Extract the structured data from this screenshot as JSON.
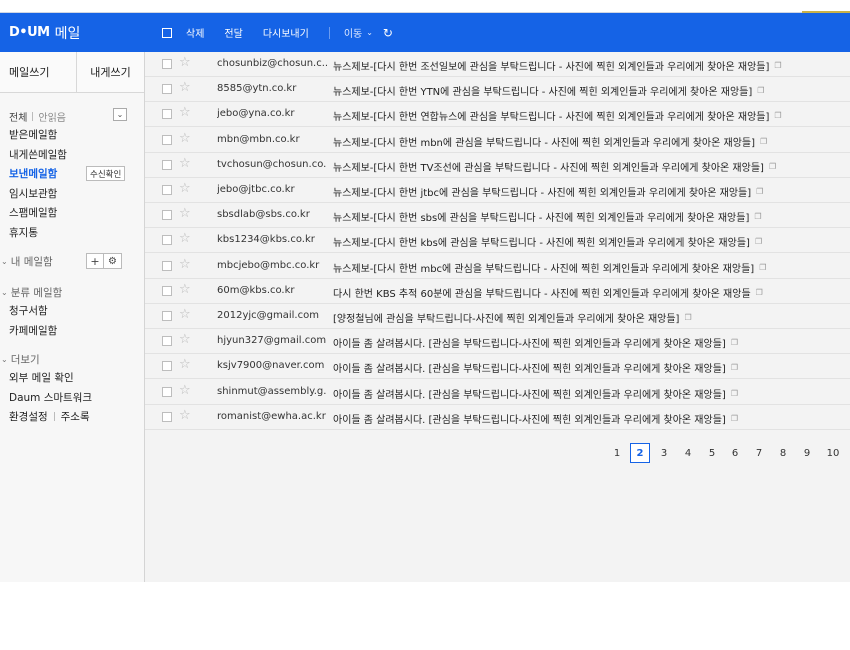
{
  "header": {
    "logo": "D•UM",
    "service": "메일",
    "toolbar": {
      "delete": "삭제",
      "forward": "전달",
      "resend": "다시보내기",
      "move": "이동"
    }
  },
  "sidebar": {
    "compose": "메일쓰기",
    "to_me": "내게쓰기",
    "filter_all": "전체",
    "filter_unread": "안읽음",
    "folders": [
      {
        "label": "받은메일함"
      },
      {
        "label": "내게쓴메일함"
      },
      {
        "label": "보낸메일함",
        "badge": "수신확인"
      },
      {
        "label": "임시보관함"
      },
      {
        "label": "스팸메일함"
      },
      {
        "label": "휴지통"
      }
    ],
    "my_mailbox": "내 메일함",
    "category_head": "분류 메일함",
    "categories": [
      {
        "label": "청구서함"
      },
      {
        "label": "카페메일함"
      }
    ],
    "more_head": "더보기",
    "more": {
      "external": "외부 메일 확인",
      "smartwork": "Daum 스마트워크",
      "settings": "환경설정",
      "contacts": "주소록"
    }
  },
  "mails": [
    {
      "from": "chosunbiz@chosun.c...",
      "subject": "뉴스제보-[다시 한번 조선일보에 관심을 부탁드립니다 - 사진에 찍힌 외계인들과 우리에게 찾아온 재앙들]"
    },
    {
      "from": "8585@ytn.co.kr",
      "subject": "뉴스제보-[다시 한번 YTN에 관심을 부탁드립니다 - 사진에 찍힌 외계인들과 우리에게 찾아온 재앙들]"
    },
    {
      "from": "jebo@yna.co.kr",
      "subject": "뉴스제보-[다시 한번 연합뉴스에 관심을 부탁드립니다 - 사진에 찍힌 외계인들과 우리에게 찾아온 재앙들]"
    },
    {
      "from": "mbn@mbn.co.kr",
      "subject": "뉴스제보-[다시 한번 mbn에 관심을 부탁드립니다 - 사진에 찍힌 외계인들과 우리에게 찾아온 재앙들]"
    },
    {
      "from": "tvchosun@chosun.co...",
      "subject": "뉴스제보-[다시 한번 TV조선에 관심을 부탁드립니다 - 사진에 찍힌 외계인들과 우리에게 찾아온 재앙들]"
    },
    {
      "from": "jebo@jtbc.co.kr",
      "subject": "뉴스제보-[다시 한번 jtbc에 관심을 부탁드립니다 - 사진에 찍힌 외계인들과 우리에게 찾아온 재앙들]"
    },
    {
      "from": "sbsdlab@sbs.co.kr",
      "subject": "뉴스제보-[다시 한번 sbs에 관심을 부탁드립니다 - 사진에 찍힌 외계인들과 우리에게 찾아온 재앙들]"
    },
    {
      "from": "kbs1234@kbs.co.kr",
      "subject": "뉴스제보-[다시 한번 kbs에 관심을 부탁드립니다 - 사진에 찍힌 외계인들과 우리에게 찾아온 재앙들]"
    },
    {
      "from": "mbcjebo@mbc.co.kr",
      "subject": "뉴스제보-[다시 한번 mbc에 관심을 부탁드립니다 - 사진에 찍힌 외계인들과 우리에게 찾아온 재앙들]"
    },
    {
      "from": "60m@kbs.co.kr",
      "subject": "다시 한번 KBS 추적 60분에 관심을 부탁드립니다 - 사진에 찍힌 외계인들과 우리에게 찾아온 재앙들"
    },
    {
      "from": "2012yjc@gmail.com",
      "subject": "[양정철님에 관심을 부탁드립니다-사진에 찍힌 외계인들과 우리에게 찾아온 재앙들]"
    },
    {
      "from": "hjyun327@gmail.com",
      "subject": "아이들 좀 살려봅시다. [관심을 부탁드립니다-사진에 찍힌 외계인들과 우리에게 찾아온 재앙들]"
    },
    {
      "from": "ksjv7900@naver.com",
      "subject": "아이들 좀 살려봅시다. [관심을 부탁드립니다-사진에 찍힌 외계인들과 우리에게 찾아온 재앙들]"
    },
    {
      "from": "shinmut@assembly.g...",
      "subject": "아이들 좀 살려봅시다. [관심을 부탁드립니다-사진에 찍힌 외계인들과 우리에게 찾아온 재앙들]"
    },
    {
      "from": "romanist@ewha.ac.kr",
      "subject": "아이들 좀 살려봅시다. [관심을 부탁드립니다-사진에 찍힌 외계인들과 우리에게 찾아온 재앙들]"
    }
  ],
  "pagination": {
    "pages": [
      "1",
      "2",
      "3",
      "4",
      "5",
      "6",
      "7",
      "8",
      "9",
      "10"
    ],
    "current": "2"
  },
  "colors": {
    "brand_blue": "#1563e6"
  }
}
